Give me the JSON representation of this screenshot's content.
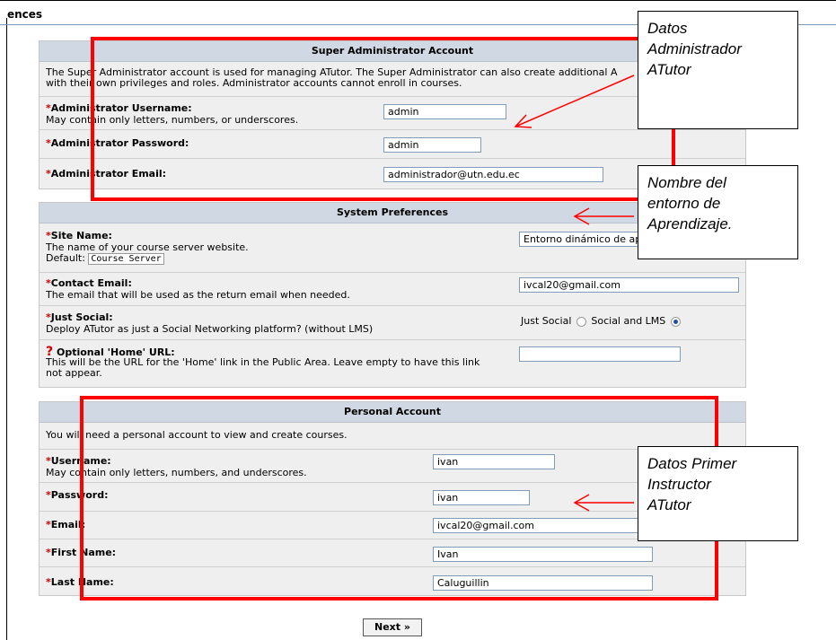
{
  "page": {
    "title_fragment": "ences"
  },
  "super_admin": {
    "heading": "Super Administrator Account",
    "intro_line1": "The Super Administrator account is used for managing ATutor. The Super Administrator can also create additional A",
    "intro_line2": "with their own privileges and roles. Administrator accounts cannot enroll in courses.",
    "username_label": "Administrator Username:",
    "username_hint": "May contain only letters, numbers, or underscores.",
    "username_value": "admin",
    "password_label": "Administrator Password:",
    "password_value": "admin",
    "email_label": "Administrator Email:",
    "email_value": "administrador@utn.edu.ec"
  },
  "system": {
    "heading": "System Preferences",
    "site_name_label": "Site Name:",
    "site_name_hint": "The name of your course server website.",
    "site_name_default_prefix": "Default:",
    "site_name_default": "Course Server",
    "site_name_value": "Entorno dinámico de ap",
    "contact_label": "Contact Email:",
    "contact_hint": "The email that will be used as the return email when needed.",
    "contact_value": "ivcal20@gmail.com",
    "just_social_label": "Just Social:",
    "just_social_hint": "Deploy ATutor as just a Social Networking platform? (without LMS)",
    "just_social_option": "Just Social",
    "social_lms_option": "Social and LMS",
    "selected_option": "Social and LMS",
    "home_url_mark": "?",
    "home_url_label": "Optional 'Home' URL:",
    "home_url_hint1": "This will be the URL for the 'Home' link in the Public Area. Leave empty to have this link",
    "home_url_hint2": "not appear.",
    "home_url_value": ""
  },
  "personal": {
    "heading": "Personal Account",
    "intro": "You will need a personal account to view and create courses.",
    "username_label": "Username:",
    "username_hint": "May contain only letters, numbers, and underscores.",
    "username_value": "ivan",
    "password_label": "Password:",
    "password_value": "ivan",
    "email_label": "Email:",
    "email_value": "ivcal20@gmail.com",
    "first_name_label": "First Name:",
    "first_name_value": "Ivan",
    "last_name_label": "Last Name:",
    "last_name_value": "Caluguillin"
  },
  "buttons": {
    "next": "Next »"
  },
  "annotations": {
    "admin_note": [
      "Datos",
      "Administrador",
      "ATutor"
    ],
    "site_note": [
      "Nombre del",
      "entorno de",
      "Aprendizaje."
    ],
    "instructor_note": [
      "Datos Primer",
      "Instructor",
      "ATutor"
    ]
  },
  "colors": {
    "highlight": "#ff0000",
    "panel_header": "#cfd8e3",
    "panel_bg": "#efefef",
    "required": "#cc0000"
  }
}
